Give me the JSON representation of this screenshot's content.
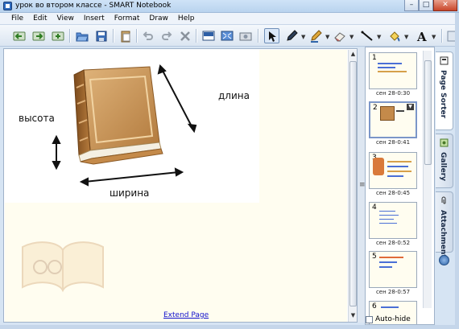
{
  "window": {
    "title": "урок во втором классе - SMART Notebook",
    "minimize": "–",
    "maximize": "□",
    "close": "✕"
  },
  "menu": [
    "File",
    "Edit",
    "View",
    "Insert",
    "Format",
    "Draw",
    "Help"
  ],
  "toolbar": {
    "icons": [
      "back-icon",
      "forward-icon",
      "add-page-icon",
      "open-icon",
      "save-icon",
      "paste-icon",
      "undo-icon",
      "redo-icon",
      "delete-icon",
      "screen-shade-icon",
      "full-screen-icon",
      "capture-icon",
      "select-icon",
      "pen-icon",
      "creative-pen-icon",
      "eraser-icon",
      "line-icon",
      "fill-icon",
      "text-icon"
    ]
  },
  "page": {
    "label_length": "длина",
    "label_height": "высота",
    "label_width": "ширина",
    "extend_link": "Extend Page"
  },
  "sorter": {
    "pages": [
      {
        "num": "1",
        "caption": "сен 28-0:30"
      },
      {
        "num": "2",
        "caption": "сен 28-0:41"
      },
      {
        "num": "3",
        "caption": "сен 28-0:45"
      },
      {
        "num": "4",
        "caption": "сен 28-0:52"
      },
      {
        "num": "5",
        "caption": "сен 28-0:57"
      },
      {
        "num": "6",
        "caption": ""
      }
    ],
    "active_page": "2",
    "autohide_label": "Auto-hide"
  },
  "side_tabs": [
    "Page Sorter",
    "Gallery",
    "Attachments"
  ],
  "colors": {
    "page_bg": "#fffdf0",
    "accent": "#2f64a8",
    "link": "#1010cc"
  }
}
